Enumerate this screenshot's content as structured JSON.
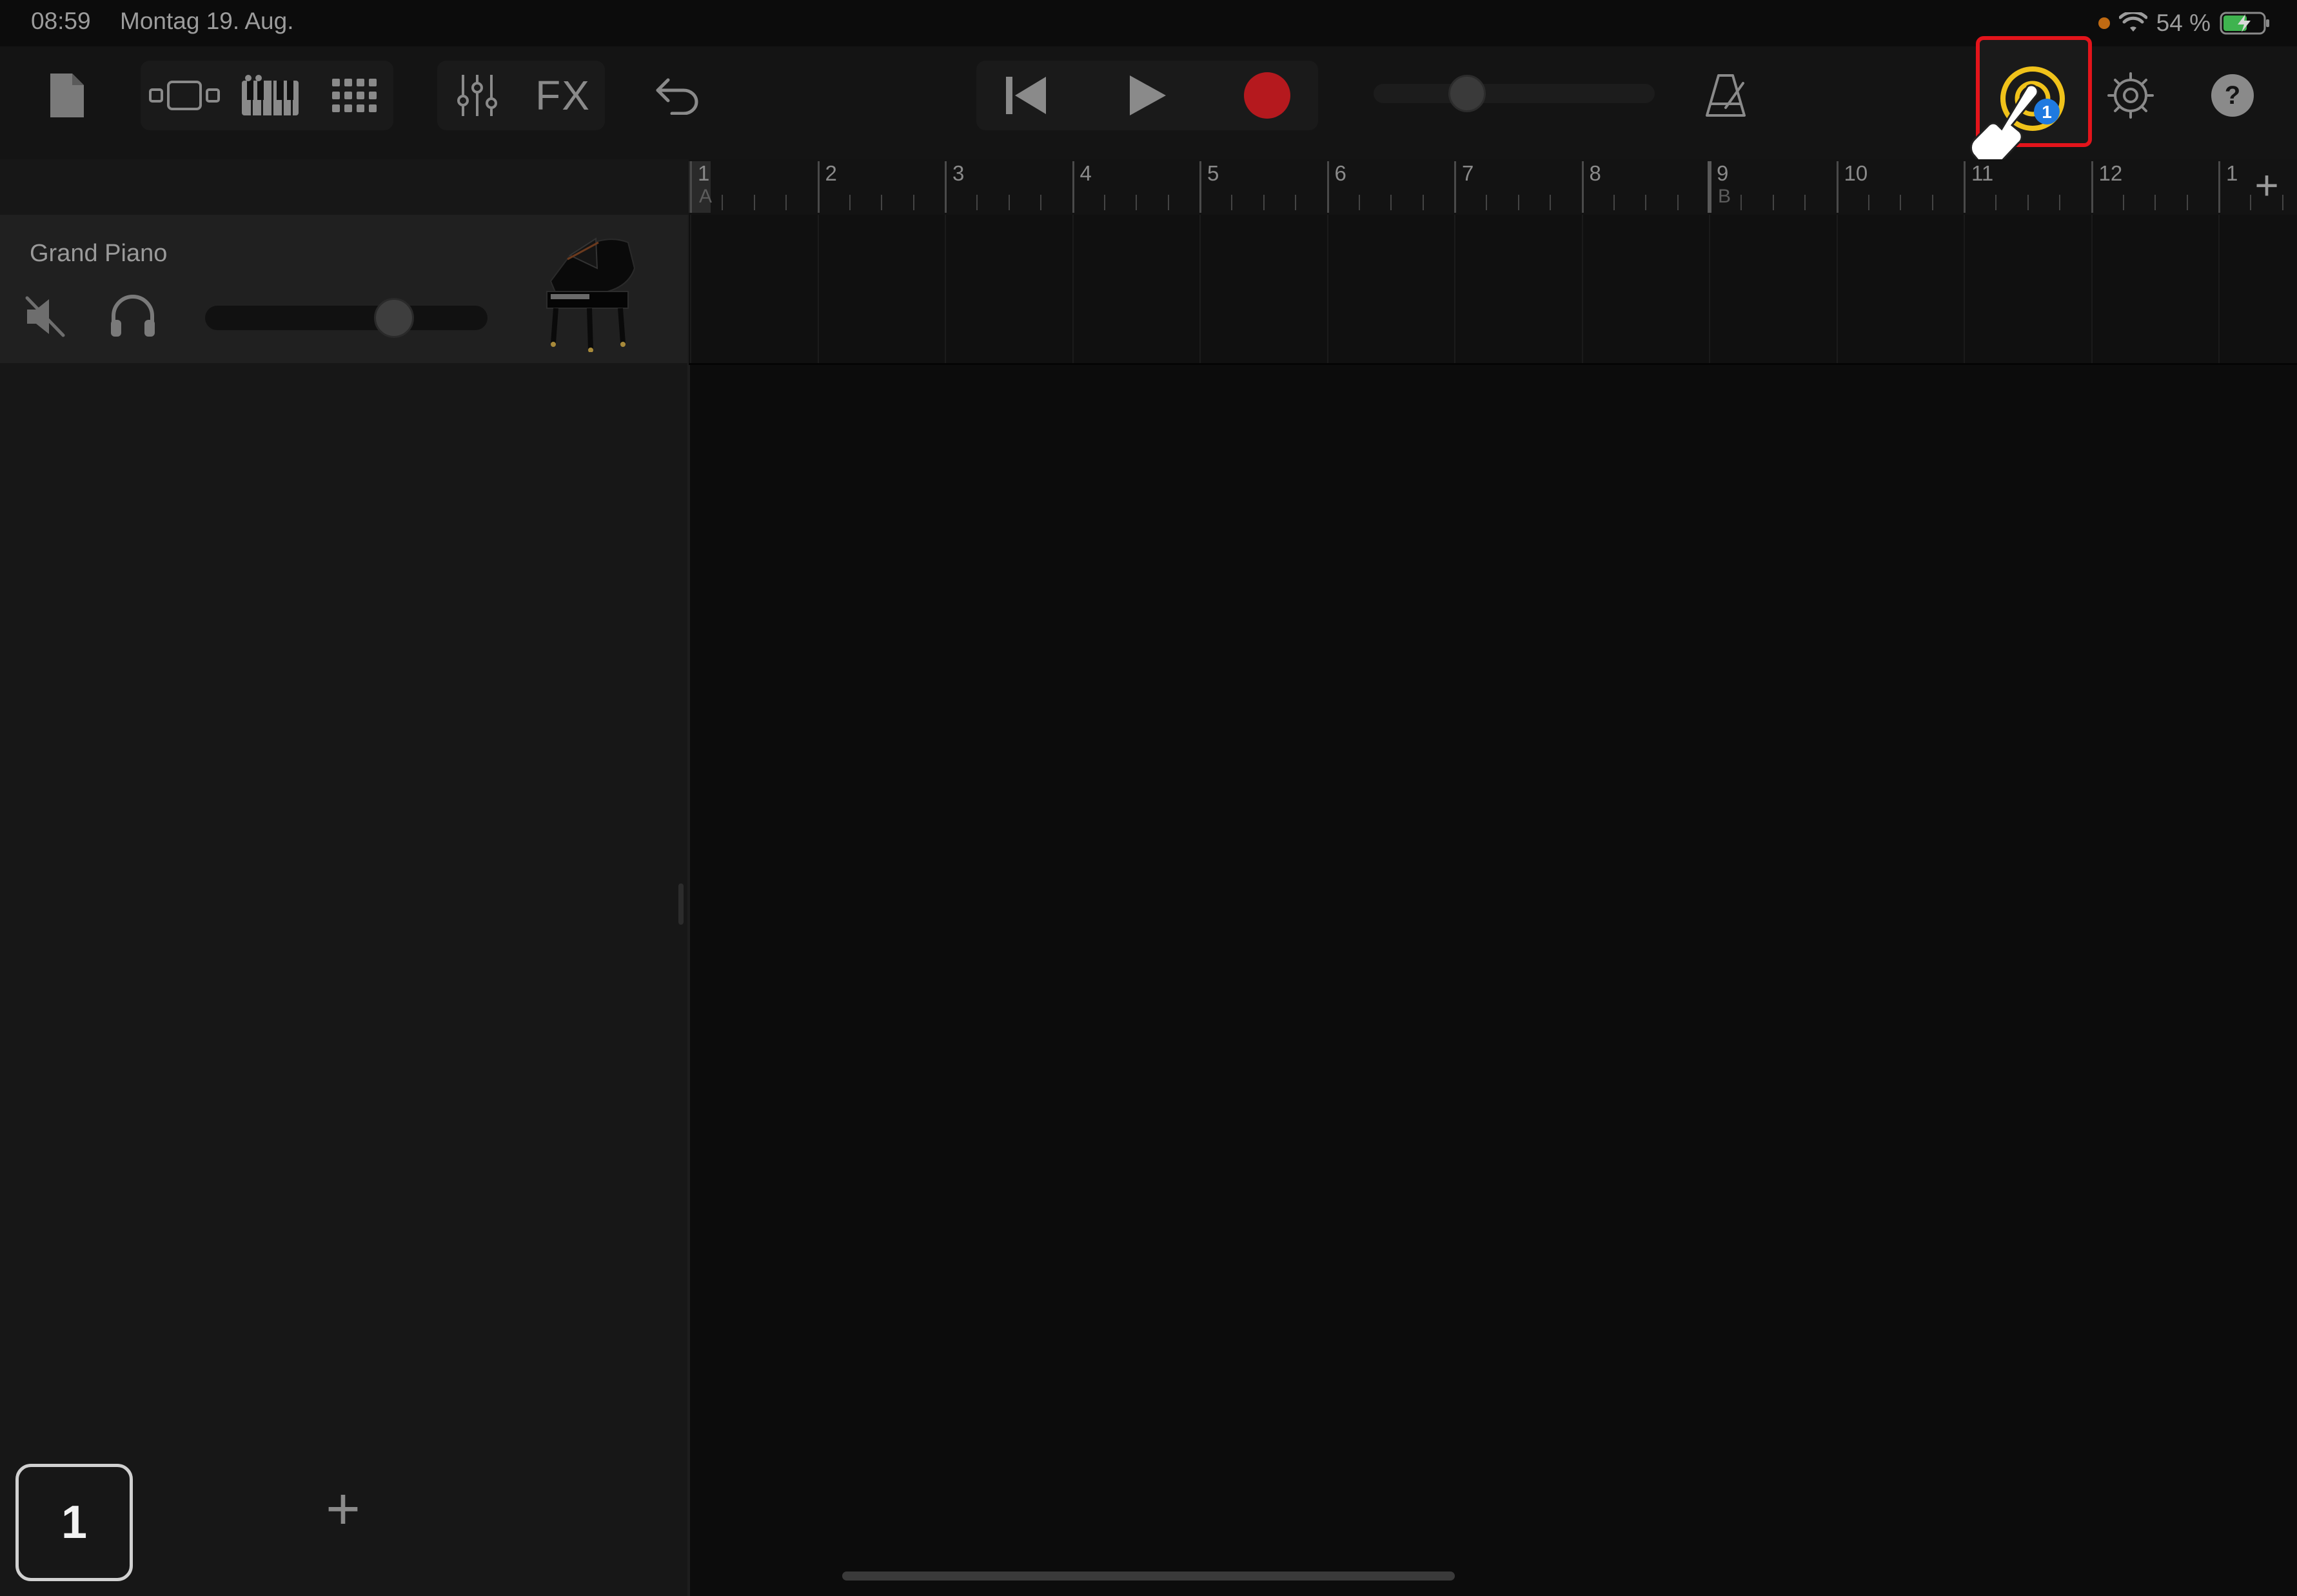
{
  "status_bar": {
    "time": "08:59",
    "date": "Montag 19. Aug.",
    "battery_percent": "54 %"
  },
  "toolbar": {
    "fx_label": "FX",
    "icons": [
      "document-icon",
      "track-view-icon",
      "keyboard-icon",
      "grid-icon",
      "mixer-icon",
      "undo-icon",
      "rewind-icon",
      "play-icon",
      "record-icon",
      "metronome-icon",
      "loop-browser-icon",
      "settings-gear-icon",
      "help-icon"
    ],
    "loop_badge": "1",
    "highlight_color": "#e3141b",
    "record_color": "#b5191e"
  },
  "ruler": {
    "bars": [
      "1",
      "2",
      "3",
      "4",
      "5",
      "6",
      "7",
      "8",
      "9",
      "10",
      "11",
      "12",
      "1"
    ],
    "markers": [
      "A",
      "B"
    ],
    "add_label": "+"
  },
  "track": {
    "name": "Grand Piano",
    "volume": 0.67
  },
  "bottom": {
    "section_number": "1",
    "add_track_label": "+"
  }
}
